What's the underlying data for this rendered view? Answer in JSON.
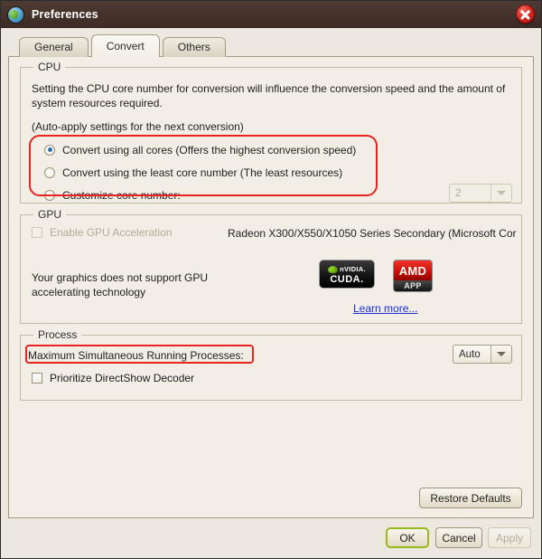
{
  "window": {
    "title": "Preferences",
    "app_icon": "globe-icon",
    "close_icon": "close-icon"
  },
  "tabs": [
    {
      "label": "General",
      "active": false
    },
    {
      "label": "Convert",
      "active": true
    },
    {
      "label": "Others",
      "active": false
    }
  ],
  "cpu": {
    "group_title": "CPU",
    "description_line1": "Setting the CPU core number for conversion will influence the conversion speed and the amount of",
    "description_line2": "system resources required.",
    "note": "(Auto-apply settings for the next conversion)",
    "options": [
      {
        "label": "Convert using all cores (Offers the highest conversion speed)",
        "selected": true
      },
      {
        "label": "Convert using the least core number (The least resources)",
        "selected": false
      },
      {
        "label": "Customize core number:",
        "selected": false
      }
    ],
    "core_spinner": {
      "value": "2",
      "enabled": false
    }
  },
  "gpu": {
    "group_title": "GPU",
    "enable_label": "Enable GPU Acceleration",
    "enable_checked": false,
    "enable_disabled": true,
    "device_name": "Radeon X300/X550/X1050 Series Secondary (Microsoft Cor",
    "status_line1": "Your graphics does not support GPU",
    "status_line2": "accelerating technology",
    "logos": [
      {
        "name": "nvidia-cuda-logo",
        "brand": "nVIDIA.",
        "sub": "CUDA."
      },
      {
        "name": "amd-app-logo",
        "brand": "AMD",
        "sub": "APP"
      }
    ],
    "learn_more": "Learn more..."
  },
  "process": {
    "group_title": "Process",
    "max_processes_label": "Maximum Simultaneous Running Processes:",
    "max_processes_value": "Auto",
    "directshow_label": "Prioritize DirectShow Decoder",
    "directshow_checked": false
  },
  "buttons": {
    "restore_defaults": "Restore Defaults",
    "ok": "OK",
    "cancel": "Cancel",
    "apply": "Apply",
    "apply_disabled": true
  },
  "annotations": {
    "accent_color": "#e8231f",
    "highlighted": [
      "cpu-radio-options",
      "max-processes-label"
    ]
  }
}
